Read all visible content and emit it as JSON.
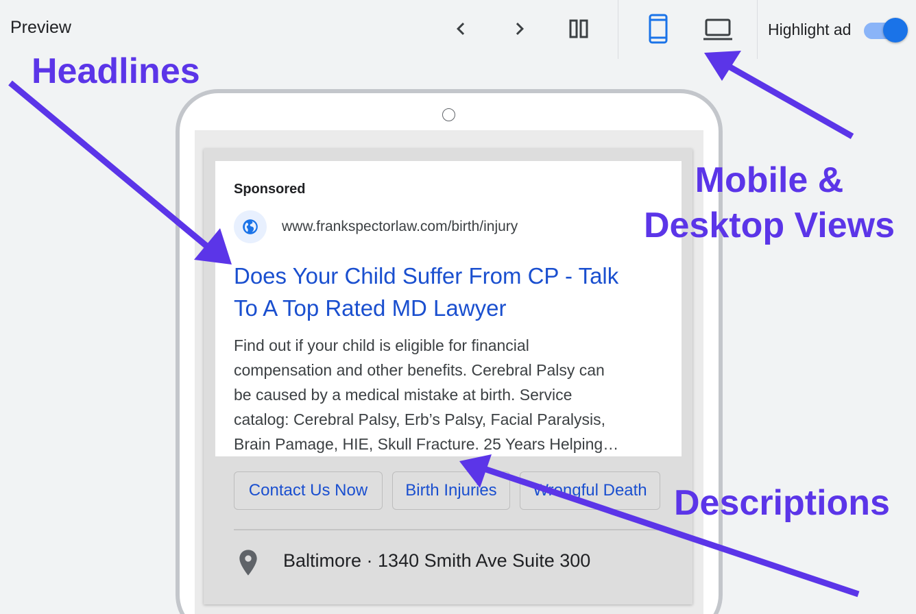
{
  "toolbar": {
    "title": "Preview",
    "prev_icon": "chevron-left-icon",
    "next_icon": "chevron-right-icon",
    "split_icon": "split-view-icon",
    "mobile_icon": "smartphone-icon",
    "desktop_icon": "laptop-icon",
    "highlight_label": "Highlight ad",
    "highlight_on": true,
    "active_view": "mobile"
  },
  "ad": {
    "sponsored_label": "Sponsored",
    "favicon_icon": "globe-icon",
    "display_url": "www.frankspectorlaw.com/birth/injury",
    "headline_line1": "Does Your Child Suffer From CP - Talk",
    "headline_line2": "To A Top Rated MD Lawyer",
    "description_lines": [
      "Find out if your child is eligible for financial",
      "compensation and other benefits. Cerebral Palsy can",
      "be caused by a medical mistake at birth. Service",
      "catalog: Cerebral Palsy, Erb’s Palsy, Facial Paralysis,",
      "Brain Pamage, HIE, Skull Fracture. 25 Years Helping…"
    ],
    "sitelinks": [
      "Contact Us Now",
      "Birth Injuries",
      "Wrongful Death"
    ],
    "location_icon": "map-pin-icon",
    "location": "Baltimore · 1340 Smith Ave Suite 300"
  },
  "annotations": {
    "headlines": "Headlines",
    "views_line1": "Mobile &",
    "views_line2": "Desktop Views",
    "descriptions": "Descriptions",
    "color": "#5b35e8"
  },
  "colors": {
    "accent": "#1a73e8",
    "headline": "#1a4fcf",
    "background": "#f1f3f4"
  }
}
